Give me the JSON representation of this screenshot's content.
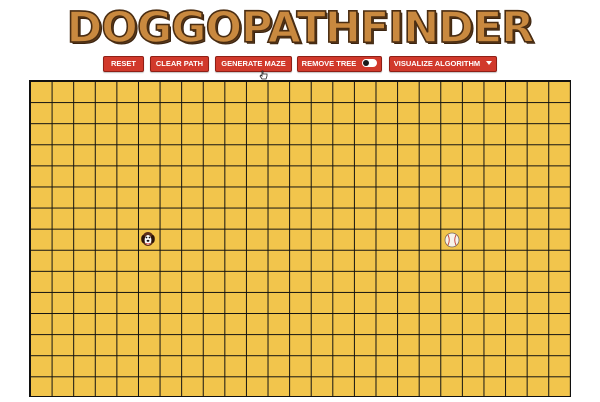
{
  "header": {
    "title": "DOGGOPATHFINDER"
  },
  "toolbar": {
    "reset_label": "RESET",
    "clear_path_label": "CLEAR PATH",
    "generate_maze_label": "GENERATE MAZE",
    "remove_tree_label": "REMOVE TREE",
    "remove_tree_toggle": "off",
    "visualize_label": "VISUALIZE ALGORITHM",
    "visualize_icon": "caret-down-icon"
  },
  "grid": {
    "columns": 25,
    "rows": 15,
    "cell_color": "#f2c54c",
    "line_color": "#101010",
    "start_icon": "dog-icon",
    "target_icon": "baseball-icon"
  },
  "colors": {
    "button_bg": "#d1392b",
    "button_text": "#ffffff",
    "title_fill": "#c9893f",
    "title_outline": "#4a2d12"
  }
}
